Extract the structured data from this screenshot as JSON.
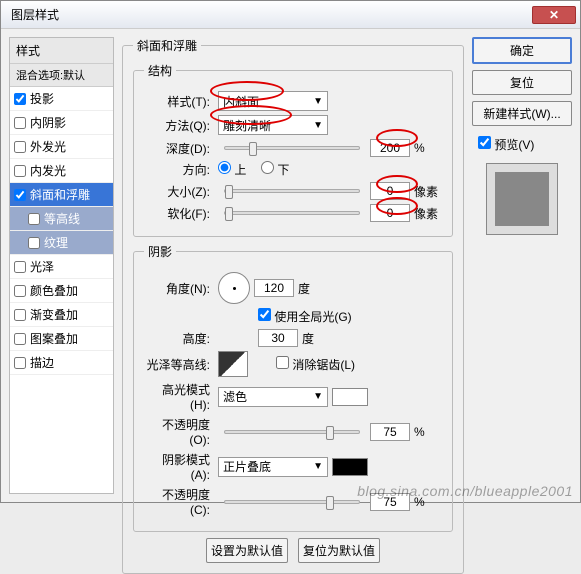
{
  "window": {
    "title": "图层样式"
  },
  "sidebar": {
    "header": "样式",
    "blend": "混合选项:默认",
    "items": [
      {
        "label": "投影",
        "checked": true
      },
      {
        "label": "内阴影",
        "checked": false
      },
      {
        "label": "外发光",
        "checked": false
      },
      {
        "label": "内发光",
        "checked": false
      },
      {
        "label": "斜面和浮雕",
        "checked": true,
        "active": true
      },
      {
        "label": "等高线",
        "checked": false,
        "sub": true
      },
      {
        "label": "纹理",
        "checked": false,
        "sub": true
      },
      {
        "label": "光泽",
        "checked": false
      },
      {
        "label": "颜色叠加",
        "checked": false
      },
      {
        "label": "渐变叠加",
        "checked": false
      },
      {
        "label": "图案叠加",
        "checked": false
      },
      {
        "label": "描边",
        "checked": false
      }
    ]
  },
  "panel": {
    "title": "斜面和浮雕",
    "structure": {
      "legend": "结构",
      "style_label": "样式(T):",
      "style_value": "内斜面",
      "method_label": "方法(Q):",
      "method_value": "雕刻清晰",
      "depth_label": "深度(D):",
      "depth_value": "200",
      "depth_unit": "%",
      "direction_label": "方向:",
      "dir_up": "上",
      "dir_down": "下",
      "size_label": "大小(Z):",
      "size_value": "0",
      "size_unit": "像素",
      "soften_label": "软化(F):",
      "soften_value": "0",
      "soften_unit": "像素"
    },
    "shading": {
      "legend": "阴影",
      "angle_label": "角度(N):",
      "angle_value": "120",
      "angle_unit": "度",
      "global_label": "使用全局光(G)",
      "altitude_label": "高度:",
      "altitude_value": "30",
      "altitude_unit": "度",
      "gloss_label": "光泽等高线:",
      "antialias_label": "消除锯齿(L)",
      "hmode_label": "高光模式(H):",
      "hmode_value": "滤色",
      "hopacity_label": "不透明度(O):",
      "hopacity_value": "75",
      "hopacity_unit": "%",
      "smode_label": "阴影模式(A):",
      "smode_value": "正片叠底",
      "sopacity_label": "不透明度(C):",
      "sopacity_value": "75",
      "sopacity_unit": "%"
    },
    "buttons": {
      "make_default": "设置为默认值",
      "reset_default": "复位为默认值"
    }
  },
  "right": {
    "ok": "确定",
    "cancel": "复位",
    "newstyle": "新建样式(W)...",
    "preview": "预览(V)"
  },
  "colors": {
    "highlight": "#ffffff",
    "shadow": "#000000"
  },
  "watermark": "blog.sina.com.cn/blueapple2001"
}
